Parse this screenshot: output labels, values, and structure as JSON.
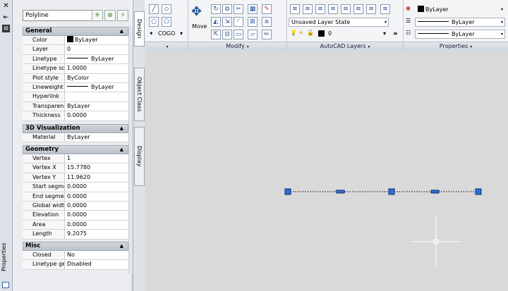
{
  "ribbon": {
    "draw_panel": {
      "cogo_label": "COGO",
      "expand_arrow": "▾"
    },
    "modify": {
      "move_label": "Move",
      "title": "Modify"
    },
    "layers": {
      "state": "Unsaved Layer State",
      "layer": "0",
      "title": "AutoCAD Layers"
    },
    "properties": {
      "color": "ByLayer",
      "linetype": "ByLayer",
      "lineweight": "ByLayer",
      "title": "Properties"
    }
  },
  "palette": {
    "title": "Properties",
    "object_type": "Polyline",
    "tabs": [
      "Design",
      "Object Class",
      "Display"
    ],
    "sections": {
      "general": {
        "title": "General",
        "color": {
          "k": "Color",
          "v": "ByLayer"
        },
        "layer": {
          "k": "Layer",
          "v": "0"
        },
        "linetype": {
          "k": "Linetype",
          "v": "ByLayer"
        },
        "linetype_scale": {
          "k": "Linetype scale",
          "v": "1.0000"
        },
        "plot_style": {
          "k": "Plot style",
          "v": "ByColor"
        },
        "lineweight": {
          "k": "Lineweight",
          "v": "ByLayer"
        },
        "hyperlink": {
          "k": "Hyperlink",
          "v": ""
        },
        "transparency": {
          "k": "Transparency",
          "v": "ByLayer"
        },
        "thickness": {
          "k": "Thickness",
          "v": "0.0000"
        }
      },
      "viz": {
        "title": "3D Visualization",
        "material": {
          "k": "Material",
          "v": "ByLayer"
        }
      },
      "geometry": {
        "title": "Geometry",
        "vertex": {
          "k": "Vertex",
          "v": "1"
        },
        "vertex_x": {
          "k": "Vertex X",
          "v": "15.7780"
        },
        "vertex_y": {
          "k": "Vertex Y",
          "v": "11.9620"
        },
        "start_seg": {
          "k": "Start segmen…",
          "v": "0.0000"
        },
        "end_seg": {
          "k": "End segment…",
          "v": "0.0000"
        },
        "global_width": {
          "k": "Global width",
          "v": "0.0000"
        },
        "elevation": {
          "k": "Elevation",
          "v": "0.0000"
        },
        "area": {
          "k": "Area",
          "v": "0.0000"
        },
        "length": {
          "k": "Length",
          "v": "9.2075"
        }
      },
      "misc": {
        "title": "Misc",
        "closed": {
          "k": "Closed",
          "v": "No"
        },
        "linetype_gen": {
          "k": "Linetype gen…",
          "v": "Disabled"
        }
      }
    }
  },
  "colors": {
    "grip": "#2f6fd8",
    "canvas": "#d9d9d9"
  }
}
